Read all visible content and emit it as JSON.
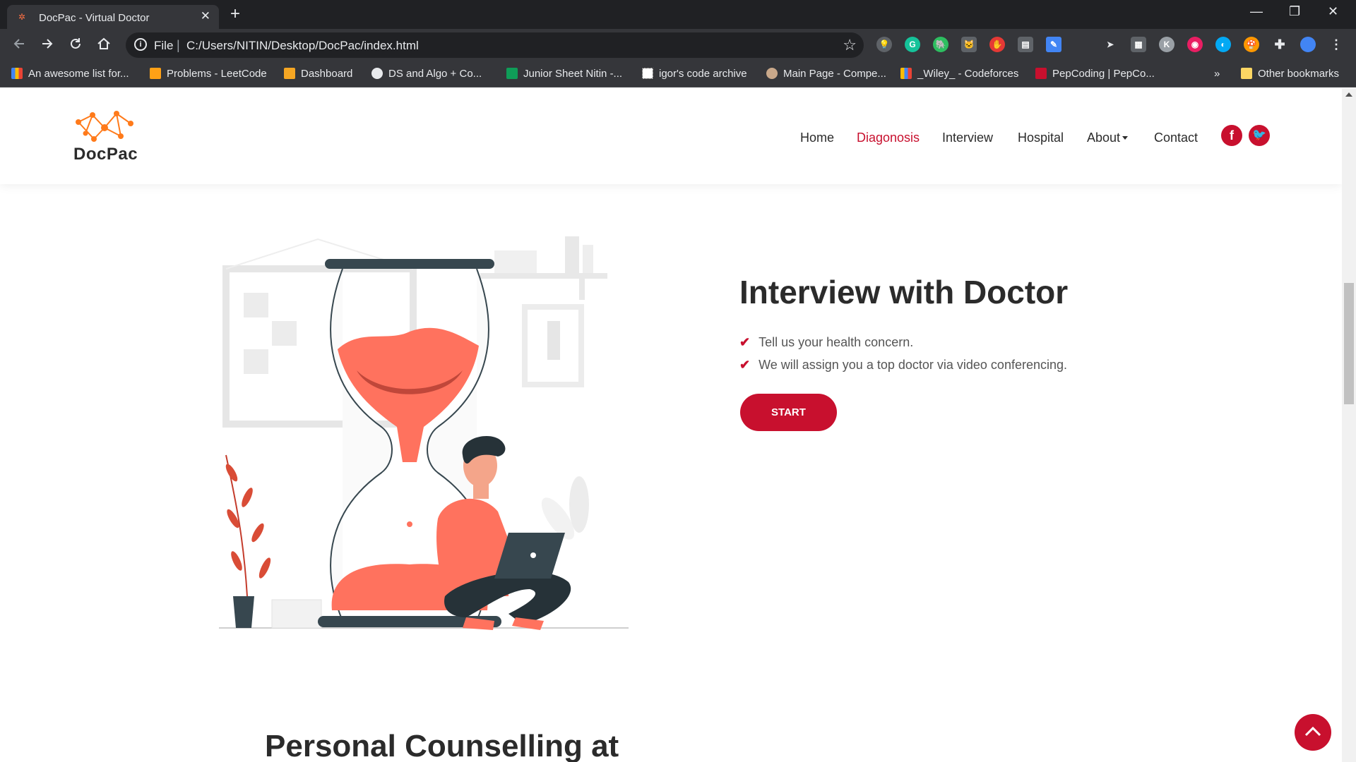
{
  "browser": {
    "tab_title": "DocPac - Virtual Doctor",
    "tab_close": "✕",
    "new_tab": "+",
    "window_controls": [
      "—",
      "❐",
      "✕"
    ],
    "address_scheme": "File",
    "address_separator": "|",
    "address_url": "C:/Users/NITIN/Desktop/DocPac/index.html",
    "bookmarks": [
      "An awesome list for...",
      "Problems - LeetCode",
      "Dashboard",
      "DS and Algo + Co...",
      "Junior Sheet Nitin -...",
      "igor's code archive",
      "Main Page - Compe...",
      "_Wiley_ - Codeforces",
      "PepCoding | PepCo..."
    ],
    "bookmarks_overflow": "»",
    "other_bookmarks": "Other bookmarks",
    "extension_letters": {
      "grammarly": "G",
      "k_ext": "K"
    }
  },
  "site": {
    "logo": "DocPac",
    "nav": [
      "Home",
      "Diagonosis",
      "Interview",
      "Hospital",
      "About",
      "Contact"
    ],
    "active_nav": "Diagonosis",
    "social": [
      "f",
      "t"
    ],
    "colors": {
      "accent": "#c8102e",
      "illustration": "#ff725e",
      "text": "#2b2b2b"
    }
  },
  "hero": {
    "heading": "Interview with Doctor",
    "bullets": [
      "Tell us your health concern.",
      "We will assign you a top doctor via video conferencing."
    ],
    "button": "START"
  },
  "next_section": {
    "heading": "Personal Counselling at"
  }
}
